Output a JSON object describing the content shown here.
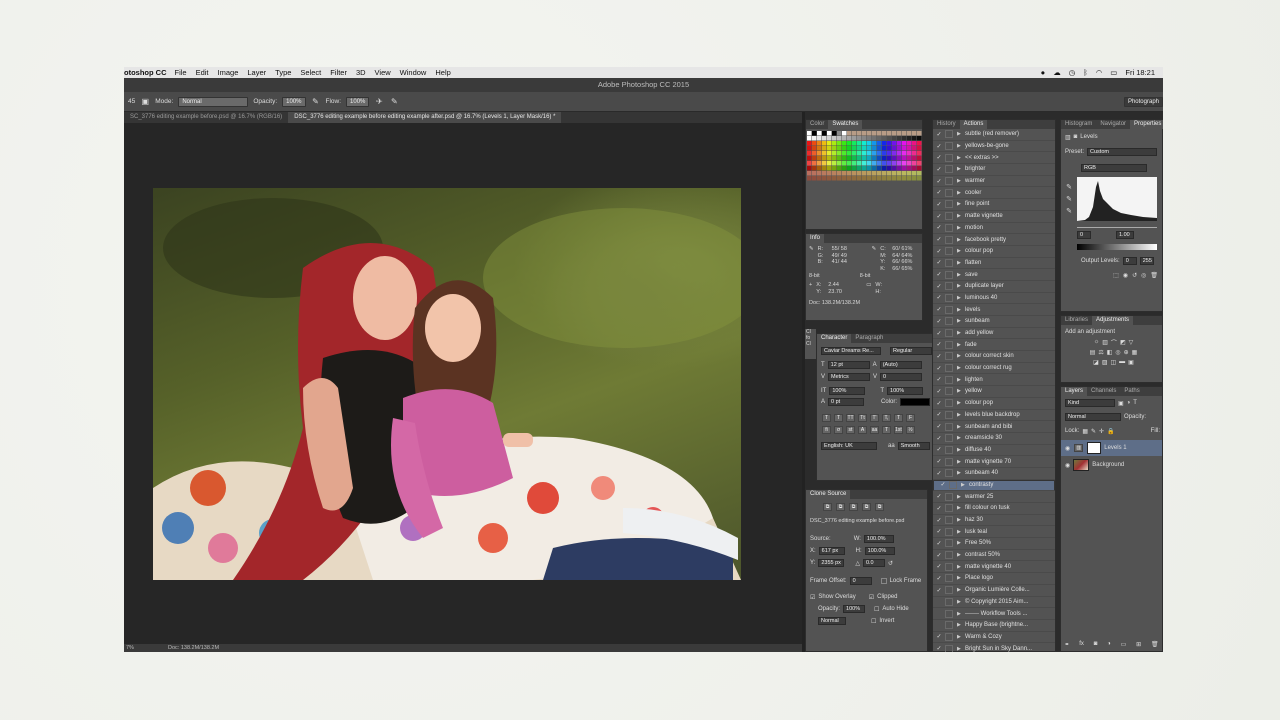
{
  "menubar": {
    "app": "otoshop CC",
    "items": [
      "File",
      "Edit",
      "Image",
      "Layer",
      "Type",
      "Select",
      "Filter",
      "3D",
      "View",
      "Window",
      "Help"
    ],
    "clock": "Fri 18:21"
  },
  "window": {
    "title": "Adobe Photoshop CC 2015"
  },
  "options": {
    "tool_number": "45",
    "mode_label": "Mode:",
    "mode_value": "Normal",
    "opacity_label": "Opacity:",
    "opacity_value": "100%",
    "flow_label": "Flow:",
    "flow_value": "100%",
    "workspace": "Photograph"
  },
  "tabs": [
    {
      "label": "SC_3776 editing example before.psd @ 16.7% (RGB/16)"
    },
    {
      "label": "DSC_3776 editing example before editing example after.psd @ 16.7% (Levels 1, Layer Mask/16) *"
    }
  ],
  "status": {
    "zoom": "7%",
    "doc": "Doc: 138.2M/138.2M"
  },
  "swatches": {
    "tabs": [
      "Color",
      "Swatches"
    ]
  },
  "info": {
    "title": "Info",
    "r": "R:",
    "g": "G:",
    "b": "B:",
    "rv": "55/ 58",
    "gv": "49/ 49",
    "bv": "41/ 44",
    "c": "C:",
    "m": "M:",
    "y": "Y:",
    "k": "K:",
    "cv": "60/ 61%",
    "mv": "64/ 64%",
    "yv": "66/ 66%",
    "kv": "66/ 65%",
    "bit1": "8-bit",
    "bit2": "8-bit",
    "x": "X:",
    "yy": "Y:",
    "xv": "2.44",
    "yyv": "23.70",
    "w": "W:",
    "h": "H:",
    "doc": "Doc: 138.2M/138.2M"
  },
  "character": {
    "tabs": [
      "Character",
      "Paragraph"
    ],
    "font": "Caviar Dreams Re...",
    "style": "Regular",
    "size": "12 pt",
    "leading": "(Auto)",
    "kerning": "Metrics",
    "tracking": "0",
    "vscale": "100%",
    "hscale": "100%",
    "baseline": "0 pt",
    "color_label": "Color:",
    "lang": "English: UK",
    "aa_label": "aa",
    "aa": "Smooth"
  },
  "clone": {
    "title": "Clone Source",
    "file": "DSC_3776 editing example before.psd",
    "source_label": "Source:",
    "w": "W:",
    "wv": "100.0%",
    "h": "H:",
    "hv": "100.0%",
    "x": "X:",
    "xv": "617 px",
    "y": "Y:",
    "yv": "2355 px",
    "angle": "0.0",
    "frame_offset": "Frame Offset:",
    "frame_value": "0",
    "lock_frame": "Lock Frame",
    "show_overlay": "Show Overlay",
    "clipped": "Clipped",
    "opacity_label": "Opacity:",
    "opacity": "100%",
    "auto_hide": "Auto Hide",
    "blend": "Normal",
    "invert": "Invert"
  },
  "history_tabs": [
    "History",
    "Actions"
  ],
  "actions": [
    {
      "label": "subtle (red remover)",
      "check": true
    },
    {
      "label": "yellows-be-gone",
      "check": true
    },
    {
      "label": "<< extras >>",
      "check": true
    },
    {
      "label": "brighter",
      "check": true
    },
    {
      "label": "warmer",
      "check": true
    },
    {
      "label": "cooler",
      "check": true
    },
    {
      "label": "fine point",
      "check": true
    },
    {
      "label": "matte vignette",
      "check": true
    },
    {
      "label": "motion",
      "check": true
    },
    {
      "label": "facebook pretty",
      "check": true
    },
    {
      "label": "colour pop",
      "check": true
    },
    {
      "label": "flatten",
      "check": true
    },
    {
      "label": "save",
      "check": true
    },
    {
      "label": "duplicate layer",
      "check": true
    },
    {
      "label": "luminous 40",
      "check": true
    },
    {
      "label": "levels",
      "check": true
    },
    {
      "label": "sunbeam",
      "check": true
    },
    {
      "label": "add yellow",
      "check": true
    },
    {
      "label": "fade",
      "check": true
    },
    {
      "label": "colour correct skin",
      "check": true
    },
    {
      "label": "colour correct rug",
      "check": true
    },
    {
      "label": "lighten",
      "check": true
    },
    {
      "label": "yellow",
      "check": true
    },
    {
      "label": "colour pop",
      "check": true
    },
    {
      "label": "levels blue backdrop",
      "check": true
    },
    {
      "label": "sunbeam and bibi",
      "check": true
    },
    {
      "label": "creamsicle 30",
      "check": true
    },
    {
      "label": "diffuse 40",
      "check": true
    },
    {
      "label": "matte vignette 70",
      "check": true
    },
    {
      "label": "sunbeam 40",
      "check": true
    },
    {
      "label": "contrasty",
      "check": true,
      "selected": true
    },
    {
      "label": "warmer 25",
      "check": true
    },
    {
      "label": "fill colour on tusk",
      "check": true
    },
    {
      "label": "haz 30",
      "check": true
    },
    {
      "label": "lusk teal",
      "check": true
    },
    {
      "label": "Free 50%",
      "check": true
    },
    {
      "label": "contrast 50%",
      "check": true
    },
    {
      "label": "matte vignette 40",
      "check": true
    },
    {
      "label": "Place logo",
      "check": true
    },
    {
      "label": "Organic Lumière Colle...",
      "check": true
    },
    {
      "label": "© Copyright 2015 Aim...",
      "check": false
    },
    {
      "label": "------- Workflow Tools ...",
      "check": false
    },
    {
      "label": "Happy Base (brightne...",
      "check": false
    },
    {
      "label": "Warm & Cozy",
      "check": true
    },
    {
      "label": "Bright Sun in Sky Dann...",
      "check": true
    }
  ],
  "properties": {
    "tabs": [
      "Histogram",
      "Navigator",
      "Properties"
    ],
    "type": "Levels",
    "preset_label": "Preset:",
    "preset": "Custom",
    "channel": "RGB",
    "input_black": "0",
    "input_gamma": "1.00",
    "output_label": "Output Levels:",
    "output_black": "0",
    "output_white": "255"
  },
  "adjustments": {
    "tabs": [
      "Libraries",
      "Adjustments"
    ],
    "title": "Add an adjustment"
  },
  "layers": {
    "tabs": [
      "Layers",
      "Channels",
      "Paths"
    ],
    "kind": "Kind",
    "blend": "Normal",
    "opacity_label": "Opacity:",
    "lock_label": "Lock:",
    "fill_label": "Fill:",
    "items": [
      {
        "name": "Levels 1"
      },
      {
        "name": "Background"
      }
    ]
  },
  "colors": {
    "accent": "#5e6e88",
    "panel": "#535353"
  }
}
